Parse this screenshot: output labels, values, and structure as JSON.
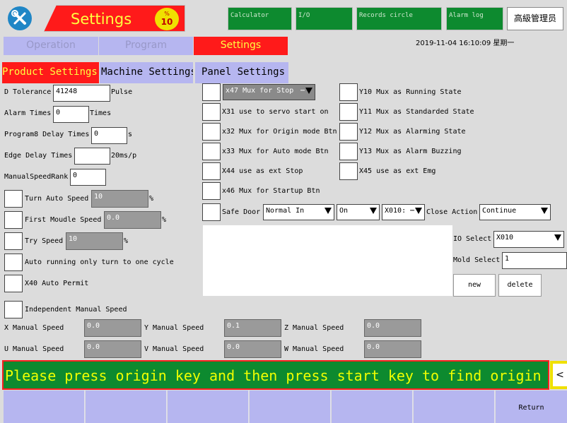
{
  "header": {
    "title": "Settings",
    "badge_top": "%",
    "badge_value": "10",
    "buttons": [
      "Calculator",
      "I/O",
      "Records circle",
      "Alarm log"
    ],
    "admin_label": "高級管理员",
    "datetime": "2019-11-04  16:10:09  星期一"
  },
  "nav_tabs": [
    "Operation",
    "Program",
    "Settings"
  ],
  "sub_tabs": [
    "Product Settings",
    "Machine Settings",
    "Panel Settings"
  ],
  "left": {
    "d_tolerance": {
      "label": "D Tolerance",
      "value": "41248",
      "unit": "Pulse"
    },
    "alarm_times": {
      "label": "Alarm Times",
      "value": "0",
      "unit": "Times"
    },
    "program8_delay": {
      "label": "Program8 Delay Times",
      "value": "0",
      "unit": "s"
    },
    "edge_delay": {
      "label": "Edge Delay Times",
      "value": "",
      "unit": "20ms/p"
    },
    "manual_speed_rank": {
      "label": "ManualSpeedRank",
      "value": "0"
    },
    "turn_auto_speed": {
      "label": "Turn Auto Speed",
      "value": "10",
      "unit": "%"
    },
    "first_module_speed": {
      "label": "First Moudle Speed",
      "value": "0.0",
      "unit": "%"
    },
    "try_speed": {
      "label": "Try Speed",
      "value": "10",
      "unit": "%"
    },
    "auto_running": {
      "label": "Auto running only turn to one cycle"
    },
    "x40_auto_permit": {
      "label": "X40 Auto Permit"
    },
    "independent_manual": {
      "label": "Independent Manual Speed"
    }
  },
  "middle": {
    "x47_select": "x47 Mux for Stop",
    "x31": "X31 use to servo start on",
    "x32": "x32 Mux for Origin mode Btn",
    "x33": "x33 Mux for Auto mode Btn",
    "x44": "X44 use as ext Stop",
    "x46": "x46 Mux for Startup Btn",
    "safe_door": "Safe Door",
    "safe_door_mode": "Normal In",
    "safe_door_state": "On",
    "safe_door_io": "X010:",
    "close_action_label": "Close Action",
    "close_action_value": "Continue"
  },
  "right": {
    "y10": "Y10 Mux as Running State",
    "y11": "Y11 Mux as Standarded State",
    "y12": "Y12 Mux as Alarming State",
    "y13": "Y13 Mux as Alarm Buzzing",
    "x45": "X45 use as ext Emg",
    "io_select_label": "IO Select",
    "io_select_value": "X010",
    "mold_select_label": "Mold Select",
    "mold_select_value": "1",
    "new_label": "new",
    "delete_label": "delete"
  },
  "manual_speeds": {
    "x": {
      "label": "X Manual Speed",
      "value": "0.0"
    },
    "y": {
      "label": "Y Manual Speed",
      "value": "0.1"
    },
    "z": {
      "label": "Z Manual Speed",
      "value": "0.0"
    },
    "u": {
      "label": "U Manual Speed",
      "value": "0.0"
    },
    "v": {
      "label": "V Manual Speed",
      "value": "0.0"
    },
    "w": {
      "label": "W Manual Speed",
      "value": "0.0"
    }
  },
  "status_message": "Please press origin key and then press start key to find origin",
  "scroll_label": "<",
  "footer": {
    "return_label": "Return"
  },
  "colors": {
    "accent_red": "#ff1a1a",
    "nav_blue": "#b6b6f0",
    "top_green": "#0d8a2f",
    "status_green": "#0d8a2f",
    "status_text": "#f0ff00"
  },
  "icons": {
    "settings": "wrench-screwdriver-icon",
    "dropdown": "triangle-down-icon"
  }
}
